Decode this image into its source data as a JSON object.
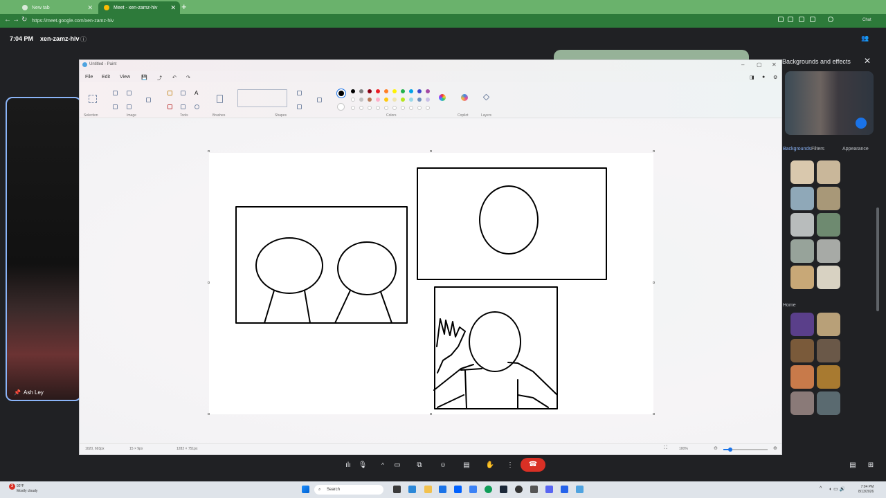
{
  "browser": {
    "tabs": [
      {
        "label": "New tab",
        "active": false
      },
      {
        "label": "Meet - xen-zamz-hiv",
        "active": true
      }
    ],
    "url": "https://meet.google.com/xen-zamz-hiv"
  },
  "meet": {
    "time": "7:04 PM",
    "meeting_code": "xen-zamz-hiv",
    "participant_name": "Ash Ley",
    "panel": {
      "title": "Backgrounds and effects",
      "tabs": [
        "Backgrounds",
        "Filters",
        "Appearance"
      ],
      "section_label": "Home"
    }
  },
  "paint": {
    "title": "Untitled - Paint",
    "menus": [
      "File",
      "Edit",
      "View"
    ],
    "ribbon_groups": [
      "Selection",
      "Image",
      "Tools",
      "Brushes",
      "Shapes",
      "Colors",
      "Copilot",
      "Layers"
    ],
    "status": {
      "cursor": "1020, 693px",
      "selection": "15 × 9px",
      "canvas_size": "1282 × 751px",
      "zoom": "100%"
    },
    "palette_row1": [
      "#000000",
      "#7f7f7f",
      "#880015",
      "#ed1c24",
      "#ff7f27",
      "#fff200",
      "#22b14c",
      "#00a2e8",
      "#3f48cc",
      "#a349a4"
    ],
    "palette_row2": [
      "#ffffff",
      "#c3c3c3",
      "#b97a57",
      "#ffaec9",
      "#ffc90e",
      "#efe4b0",
      "#b5e61d",
      "#99d9ea",
      "#7092be",
      "#c8bfe7"
    ]
  },
  "taskbar": {
    "weather_temp": "92°F",
    "weather_desc": "Mostly cloudy",
    "search_label": "Search",
    "clock_time": "7:04 PM",
    "clock_date": "8/13/2026",
    "notification_count": "3"
  }
}
